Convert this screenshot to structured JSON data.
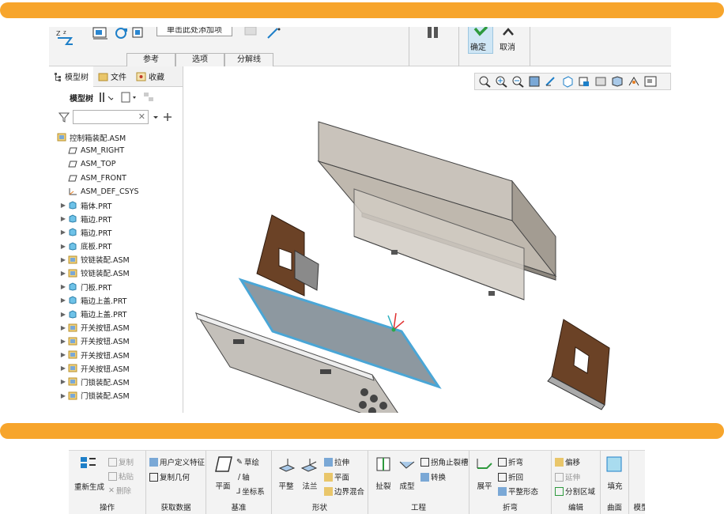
{
  "shot1": {
    "toolbar": {
      "add_item_label": "单击此处添加项",
      "ok_label": "确定",
      "cancel_label": "取消"
    },
    "sub_tabs": [
      "参考",
      "选项",
      "分解线"
    ],
    "panel_tabs": [
      "模型树",
      "文件",
      "收藏"
    ],
    "model_tree_label": "模型树",
    "search": {
      "value": "",
      "placeholder": ""
    },
    "tree": [
      {
        "label": "控制箱装配.ASM",
        "icon": "assembly-icon",
        "level": 0,
        "expandable": false
      },
      {
        "label": "ASM_RIGHT",
        "icon": "datum-plane-icon",
        "level": 1,
        "expandable": false
      },
      {
        "label": "ASM_TOP",
        "icon": "datum-plane-icon",
        "level": 1,
        "expandable": false
      },
      {
        "label": "ASM_FRONT",
        "icon": "datum-plane-icon",
        "level": 1,
        "expandable": false
      },
      {
        "label": "ASM_DEF_CSYS",
        "icon": "csys-icon",
        "level": 1,
        "expandable": false
      },
      {
        "label": "箱体.PRT",
        "icon": "part-icon",
        "level": 1,
        "expandable": true
      },
      {
        "label": "箱边.PRT",
        "icon": "part-icon",
        "level": 1,
        "expandable": true
      },
      {
        "label": "箱边.PRT",
        "icon": "part-icon",
        "level": 1,
        "expandable": true
      },
      {
        "label": "底板.PRT",
        "icon": "part-icon",
        "level": 1,
        "expandable": true
      },
      {
        "label": "铰链装配.ASM",
        "icon": "assembly-icon",
        "level": 1,
        "expandable": true
      },
      {
        "label": "铰链装配.ASM",
        "icon": "assembly-icon",
        "level": 1,
        "expandable": true
      },
      {
        "label": "门板.PRT",
        "icon": "part-icon",
        "level": 1,
        "expandable": true
      },
      {
        "label": "箱边上盖.PRT",
        "icon": "part-icon",
        "level": 1,
        "expandable": true
      },
      {
        "label": "箱边上盖.PRT",
        "icon": "part-icon",
        "level": 1,
        "expandable": true
      },
      {
        "label": "开关按钮.ASM",
        "icon": "assembly-icon",
        "level": 1,
        "expandable": true
      },
      {
        "label": "开关按钮.ASM",
        "icon": "assembly-icon",
        "level": 1,
        "expandable": true
      },
      {
        "label": "开关按钮.ASM",
        "icon": "assembly-icon",
        "level": 1,
        "expandable": true
      },
      {
        "label": "开关按钮.ASM",
        "icon": "assembly-icon",
        "level": 1,
        "expandable": true
      },
      {
        "label": "门锁装配.ASM",
        "icon": "assembly-icon",
        "level": 1,
        "expandable": true
      },
      {
        "label": "门锁装配.ASM",
        "icon": "assembly-icon",
        "level": 1,
        "expandable": true
      }
    ],
    "colors": {
      "sheet_metal": "#c8c2ba",
      "door_panel": "#6b4226",
      "glass_edge": "#4aa6d6",
      "accent": "#F7A52C"
    }
  },
  "shot2": {
    "groups": {
      "operations": {
        "label": "操作",
        "regenerate": "重新生成",
        "copy": "复制",
        "paste": "粘贴",
        "delete": "删除"
      },
      "get_data": {
        "label": "获取数据",
        "udf": "用户定义特征",
        "copy_geometry": "复制几何"
      },
      "datum": {
        "label": "基准",
        "plane": "平面",
        "sketch": "草绘",
        "axis": "轴",
        "csys": "坐标系"
      },
      "shape": {
        "label": "形状",
        "flat": "平整",
        "flange": "法兰",
        "extrude": "拉伸",
        "planar": "平面",
        "boundary_blend": "边界混合"
      },
      "engineering": {
        "label": "工程",
        "rip": "扯裂",
        "form": "成型",
        "corner_relief": "拐角止裂槽",
        "convert": "转换"
      },
      "bend": {
        "label": "折弯",
        "unbend": "展平",
        "bend": "折弯",
        "bend_back": "折回",
        "flat_pattern": "平整形态"
      },
      "editing": {
        "label": "编辑",
        "offset": "偏移",
        "extend": "延伸",
        "split_area": "分割区域"
      },
      "surface": {
        "label": "曲面",
        "fill": "填充"
      },
      "model": {
        "label": "模型"
      }
    }
  }
}
